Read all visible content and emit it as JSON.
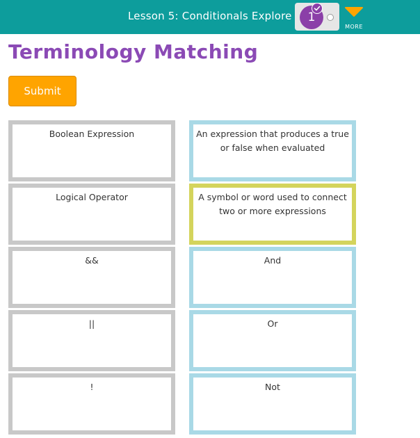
{
  "header": {
    "lesson_title": "Lesson 5: Conditionals Explore",
    "progress_level": "1",
    "more_label": "MORE"
  },
  "page_title": "Terminology Matching",
  "submit_label": "Submit",
  "terms": [
    {
      "label": "Boolean Expression"
    },
    {
      "label": "Logical Operator"
    },
    {
      "label": "&&"
    },
    {
      "label": "||"
    },
    {
      "label": "!"
    }
  ],
  "definitions": [
    {
      "label": "An expression that produces a true or false when evaluated"
    },
    {
      "label": "A symbol or word used to connect two or more expressions",
      "selected": true
    },
    {
      "label": "And"
    },
    {
      "label": "Or"
    },
    {
      "label": "Not"
    }
  ],
  "colors": {
    "header_bg": "#0d9d9c",
    "title": "#8b4ab5",
    "submit_bg": "#ffa400",
    "term_border": "#c8c8c8",
    "definition_border": "#a9d9e6",
    "selected_border": "#d4d45c"
  }
}
